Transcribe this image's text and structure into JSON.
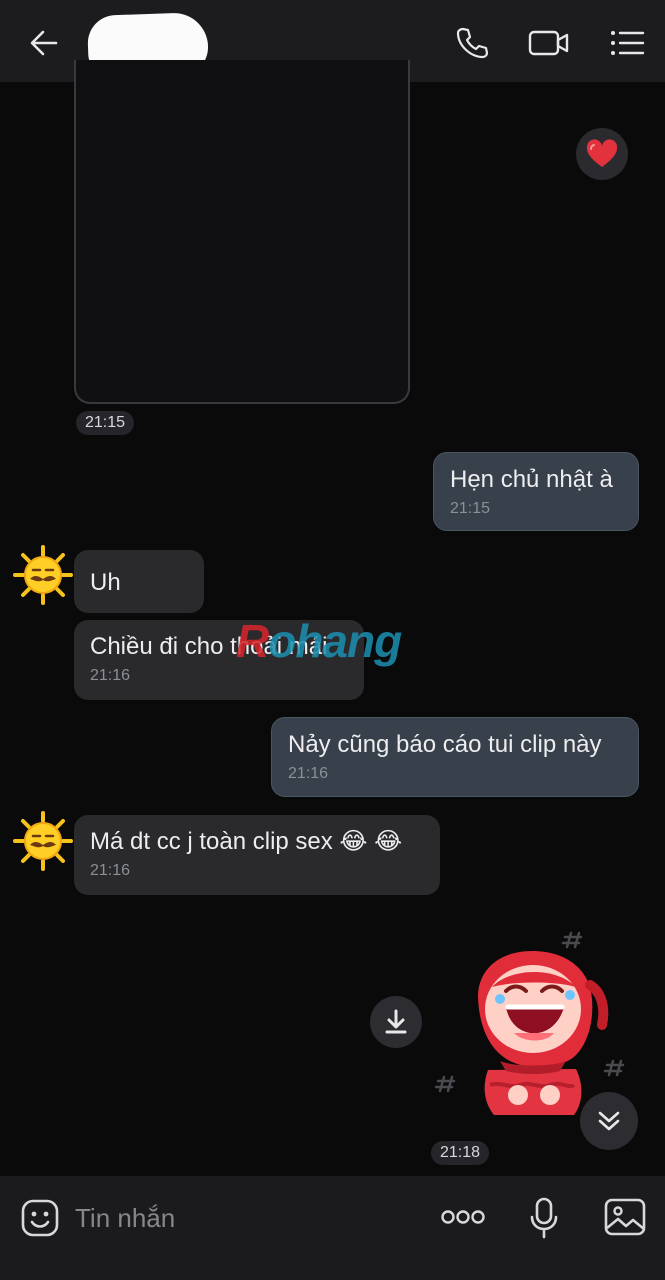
{
  "header": {
    "back_icon": "arrow-left-icon",
    "contact_name_redacted": true,
    "actions": [
      "phone-icon",
      "video-camera-icon",
      "list-menu-icon"
    ]
  },
  "messages": [
    {
      "type": "media",
      "direction": "incoming",
      "time": "21:15",
      "reaction": "heart-icon"
    },
    {
      "type": "text",
      "direction": "outgoing",
      "text": "Hẹn chủ nhật à",
      "time": "21:15"
    },
    {
      "type": "text",
      "direction": "incoming",
      "text": "Uh"
    },
    {
      "type": "text",
      "direction": "incoming",
      "text": "Chiều đi cho thoải mái",
      "time": "21:16"
    },
    {
      "type": "text",
      "direction": "outgoing",
      "text": "Nảy cũng báo cáo tui clip này",
      "time": "21:16"
    },
    {
      "type": "text",
      "direction": "incoming",
      "text": "Má dt cc j toàn clip sex 😂 😂",
      "time": "21:16"
    },
    {
      "type": "sticker",
      "direction": "outgoing",
      "time": "21:18"
    }
  ],
  "watermark": {
    "prefix": "R",
    "rest": "ohang"
  },
  "composer": {
    "placeholder": "Tin nhắn",
    "icons": [
      "emoji-icon",
      "more-dots-icon",
      "microphone-icon",
      "image-icon"
    ]
  },
  "colors": {
    "header_bg": "#1c1c1f",
    "incoming_bubble": "#2a2a2d",
    "outgoing_bubble": "#37404b",
    "background": "#0a0a0b"
  }
}
